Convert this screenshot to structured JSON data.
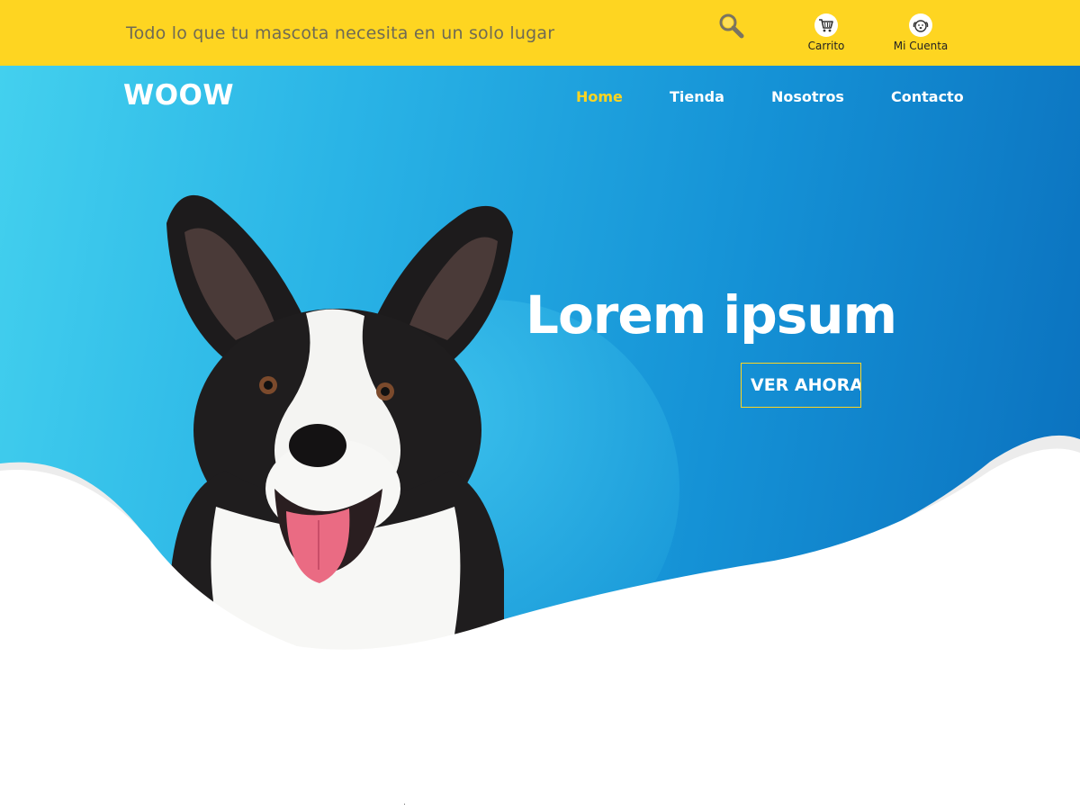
{
  "topbar": {
    "tagline": "Todo lo que tu mascota necesita en un solo lugar",
    "search_icon": "search-icon",
    "cart": {
      "label": "Carrito",
      "icon": "cart-icon"
    },
    "account": {
      "label": "Mi Cuenta",
      "icon": "dog-face-icon"
    }
  },
  "header": {
    "logo": "WOOW",
    "nav": [
      {
        "label": "Home",
        "active": true
      },
      {
        "label": "Tienda",
        "active": false
      },
      {
        "label": "Nosotros",
        "active": false
      },
      {
        "label": "Contacto",
        "active": false
      }
    ]
  },
  "hero": {
    "headline": "Lorem ipsum",
    "cta_label": "VER AHORA",
    "image": "corgi-dog-photo"
  },
  "colors": {
    "topbar_bg": "#fed521",
    "active_nav": "#fed521",
    "hero_gradient_start": "#43d0ee",
    "hero_gradient_end": "#0a6fbd",
    "text_white": "#ffffff"
  }
}
